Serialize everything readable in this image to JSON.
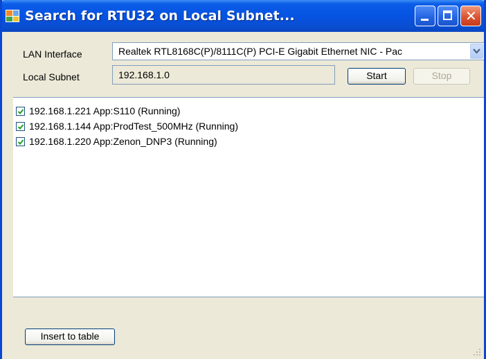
{
  "window": {
    "title": "Search for RTU32 on Local Subnet...",
    "accent": "#0a46d4",
    "close_color": "#dd5432",
    "title_buttons": [
      "minimize-icon",
      "maximize-icon",
      "close-icon"
    ]
  },
  "form": {
    "lan_label": "LAN Interface",
    "lan_value": "Realtek RTL8168C(P)/8111C(P) PCI-E Gigabit Ethernet NIC - Pac",
    "subnet_label": "Local Subnet",
    "subnet_value": "192.168.1.0",
    "start_label": "Start",
    "stop_label": "Stop"
  },
  "results": [
    {
      "checked": true,
      "text": "192.168.1.221  App:S110 (Running)"
    },
    {
      "checked": true,
      "text": "192.168.1.144  App:ProdTest_500MHz (Running)"
    },
    {
      "checked": true,
      "text": "192.168.1.220  App:Zenon_DNP3 (Running)"
    }
  ],
  "footer": {
    "insert_label": "Insert to table"
  }
}
